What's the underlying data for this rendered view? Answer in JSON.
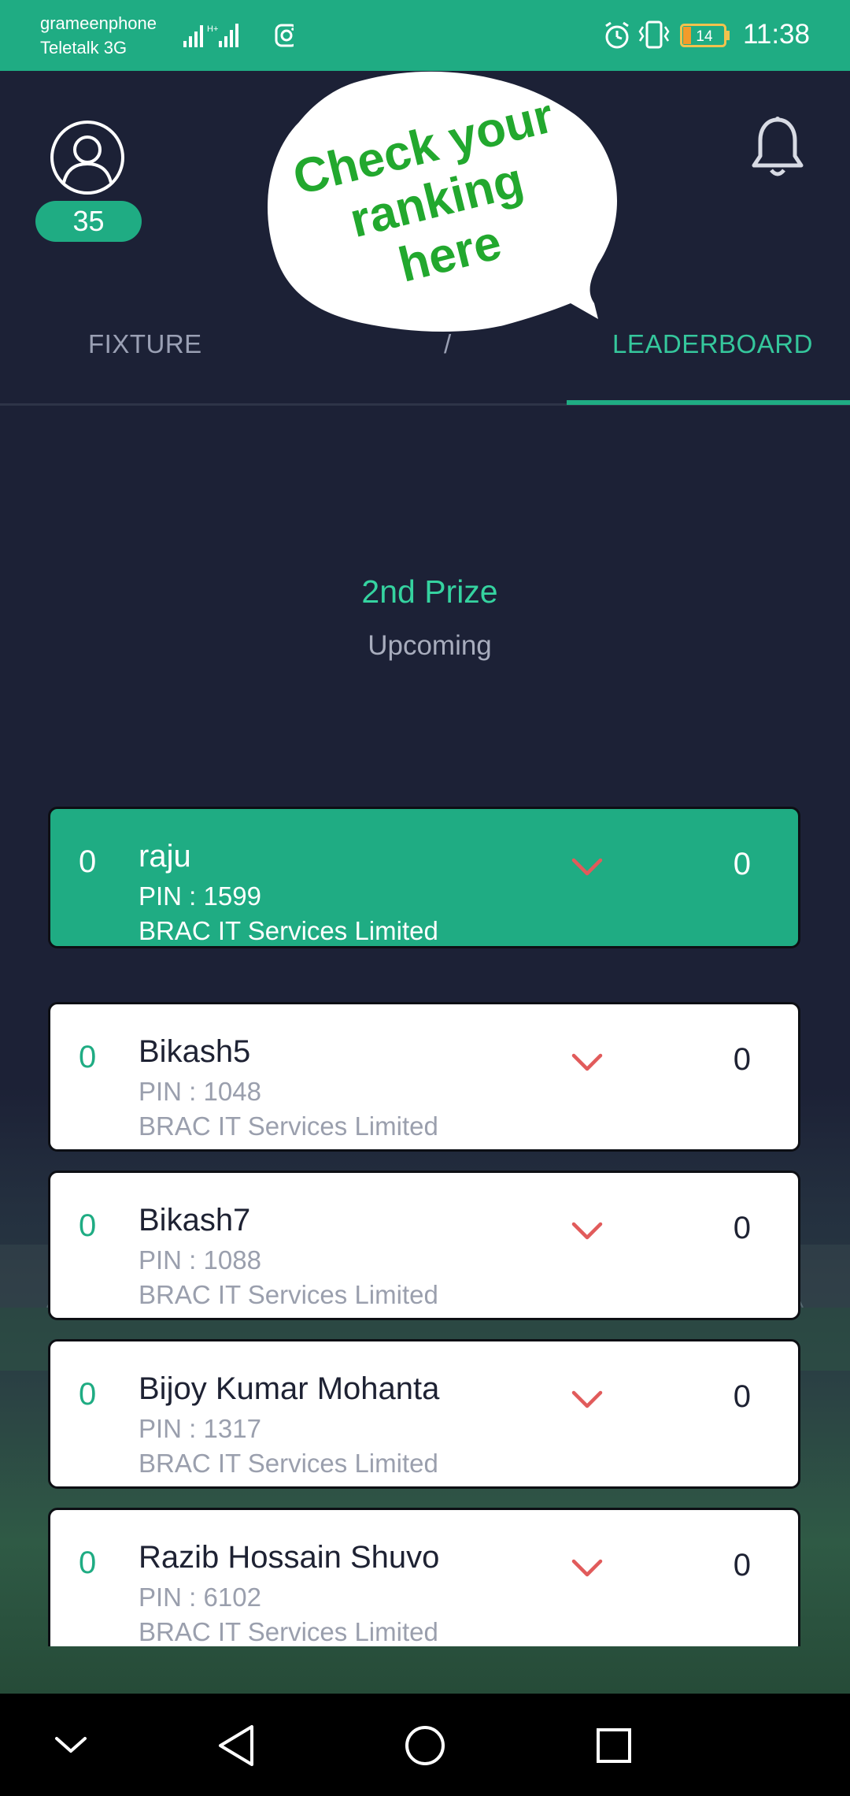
{
  "status_bar": {
    "carrier_1": "grameenphone",
    "carrier_2": "Teletalk 3G",
    "battery": "14",
    "time": "11:38"
  },
  "header": {
    "points": "35"
  },
  "callout": {
    "lines": [
      "Check your",
      "ranking",
      "here"
    ]
  },
  "tabs": {
    "fixture": "FIXTURE",
    "center_partial": "/",
    "leaderboard": "LEADERBOARD"
  },
  "prize": {
    "title": "2nd Prize",
    "status": "Upcoming"
  },
  "leaderboard": [
    {
      "rank": "0",
      "name": "raju",
      "pin": "PIN : 1599",
      "org": "BRAC IT Services Limited",
      "score": "0",
      "highlight": true
    },
    {
      "rank": "0",
      "name": "Bikash5",
      "pin": "PIN : 1048",
      "org": "BRAC IT Services Limited",
      "score": "0"
    },
    {
      "rank": "0",
      "name": "Bikash7",
      "pin": "PIN : 1088",
      "org": "BRAC IT Services Limited",
      "score": "0"
    },
    {
      "rank": "0",
      "name": "Bijoy Kumar Mohanta",
      "pin": "PIN : 1317",
      "org": "BRAC IT Services Limited",
      "score": "0"
    },
    {
      "rank": "0",
      "name": "Razib Hossain Shuvo",
      "pin": "PIN : 6102",
      "org": "BRAC IT Services Limited",
      "score": "0"
    }
  ],
  "colors": {
    "accent": "#1fac83",
    "background": "#1c2136",
    "trend_down": "#e15b5b"
  },
  "icons": [
    "signal-icon",
    "instagram-icon",
    "alarm-icon",
    "vibrate-icon",
    "battery-icon",
    "avatar-icon",
    "bell-icon",
    "chevron-down-icon",
    "back-icon",
    "home-icon",
    "recents-icon"
  ]
}
